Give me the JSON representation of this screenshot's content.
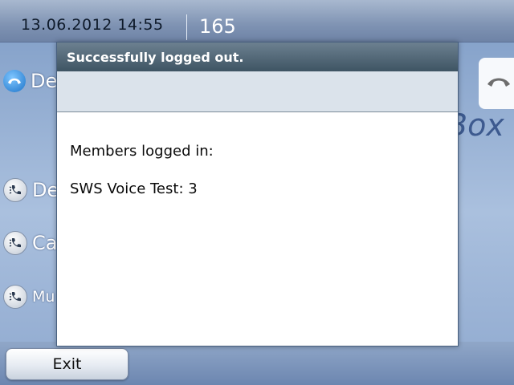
{
  "status_bar": {
    "datetime": "13.06.2012 14:55",
    "extension": "165"
  },
  "background_items": [
    {
      "label": "De",
      "icon": "handset-icon"
    },
    {
      "label": "De",
      "icon": "handset-ring-icon"
    },
    {
      "label": "Ca",
      "icon": "handset-ring-icon"
    },
    {
      "label": "Mu",
      "icon": "handset-ring-icon"
    }
  ],
  "background_right_text": "Box",
  "dialog": {
    "title": "Successfully logged out.",
    "body_lines": [
      "Members logged in:",
      "SWS Voice Test: 3"
    ]
  },
  "bottom_bar": {
    "exit_label": "Exit"
  },
  "colors": {
    "accent_blue": "#1d74c9",
    "dialog_title_bg": "#3e5463",
    "subbar_bg": "#dbe3eb"
  }
}
